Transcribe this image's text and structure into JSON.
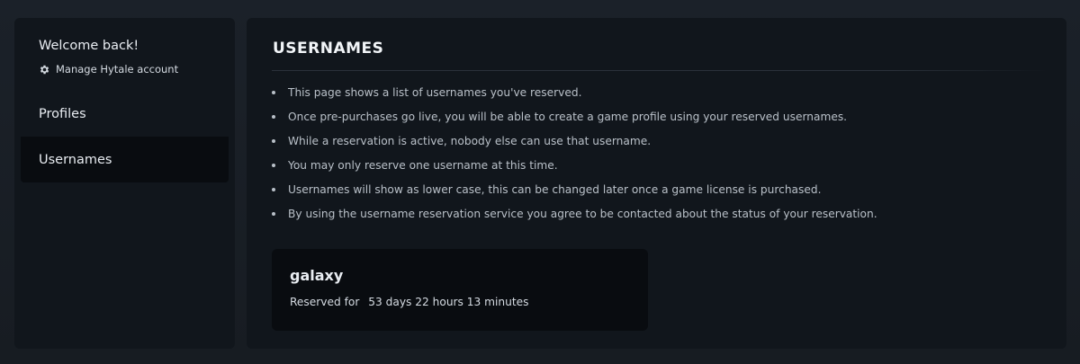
{
  "sidebar": {
    "welcome": "Welcome back!",
    "manage_label": "Manage Hytale account",
    "manage_icon": "gear-icon",
    "items": [
      {
        "label": "Profiles",
        "active": false
      },
      {
        "label": "Usernames",
        "active": true
      }
    ]
  },
  "main": {
    "title": "USERNAMES",
    "bullets": [
      "This page shows a list of usernames you've reserved.",
      "Once pre-purchases go live, you will be able to create a game profile using your reserved usernames.",
      "While a reservation is active, nobody else can use that username.",
      "You may only reserve one username at this time.",
      "Usernames will show as lower case, this can be changed later once a game license is purchased.",
      "By using the username reservation service you agree to be contacted about the status of your reservation."
    ],
    "card": {
      "username": "galaxy",
      "reserved_label": "Reserved for",
      "reserved_value": "53 days 22 hours 13 minutes"
    }
  },
  "colors": {
    "background": "#1a1f26",
    "panel": "#11161c",
    "active_item": "#090c10",
    "text_primary": "#e9edf2",
    "text_secondary": "#b9c0c8"
  }
}
